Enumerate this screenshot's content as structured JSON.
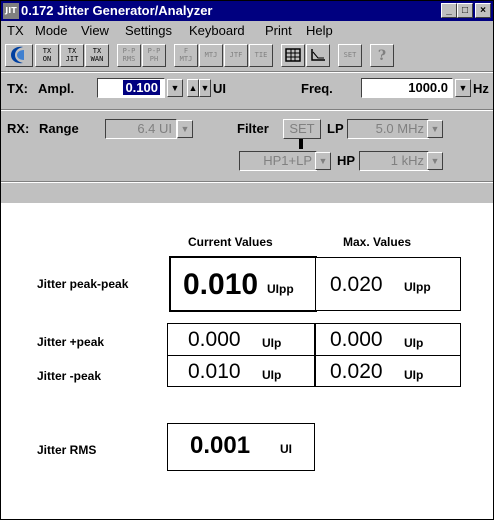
{
  "window": {
    "icon_text": "JIT",
    "title": "0.172 Jitter Generator/Analyzer",
    "minimize": "_",
    "maximize": "□",
    "close": "×"
  },
  "menu": [
    "TX",
    "Mode",
    "View",
    "Settings",
    "Keyboard",
    "Print",
    "Help"
  ],
  "toolbar": {
    "buttons": [
      {
        "icon": "logo-icon"
      },
      {
        "line1": "TX",
        "line2": "ON"
      },
      {
        "line1": "TX",
        "line2": "JIT"
      },
      {
        "line1": "TX",
        "line2": "WAN"
      },
      {
        "line1": "P-P",
        "line2": "RMS"
      },
      {
        "line1": "P-P",
        "line2": "PH"
      },
      {
        "line1": "F",
        "line2": "MTJ"
      },
      {
        "line1": "MTJ",
        "line2": ""
      },
      {
        "line1": "JTF",
        "line2": ""
      },
      {
        "line1": "TIE",
        "line2": ""
      },
      {
        "icon": "table-icon"
      },
      {
        "icon": "graph-icon"
      },
      {
        "line1": "SET",
        "line2": ""
      },
      {
        "icon": "help-icon"
      }
    ]
  },
  "tx": {
    "label": "TX:",
    "ampl_label": "Ampl.",
    "ampl_value": "0.100",
    "ampl_unit": "UI",
    "freq_label": "Freq.",
    "freq_value": "1000.0",
    "freq_unit": "Hz"
  },
  "rx": {
    "label": "RX:",
    "range_label": "Range",
    "range_value": "6.4 UI",
    "filter_label": "Filter",
    "set_label": "SET",
    "lp_label": "LP",
    "lp_value": "5.0 MHz",
    "mode_value": "HP1+LP",
    "hp_label": "HP",
    "hp_value": "1 kHz"
  },
  "measurements": {
    "current_header": "Current Values",
    "max_header": "Max. Values",
    "peak_peak": {
      "label": "Jitter  peak-peak",
      "current": "0.010",
      "current_unit": "UIpp",
      "max": "0.020",
      "max_unit": "UIpp"
    },
    "plus_peak": {
      "label": "Jitter  +peak",
      "current": "0.000",
      "current_unit": "UIp",
      "max": "0.000",
      "max_unit": "UIp"
    },
    "minus_peak": {
      "label": "Jitter  -peak",
      "current": "0.010",
      "current_unit": "UIp",
      "max": "0.020",
      "max_unit": "UIp"
    },
    "rms": {
      "label": "Jitter RMS",
      "value": "0.001",
      "unit": "UI"
    }
  },
  "colors": {
    "titlebar": "#000080",
    "face": "#c0c0c0",
    "selection": "#000080"
  }
}
